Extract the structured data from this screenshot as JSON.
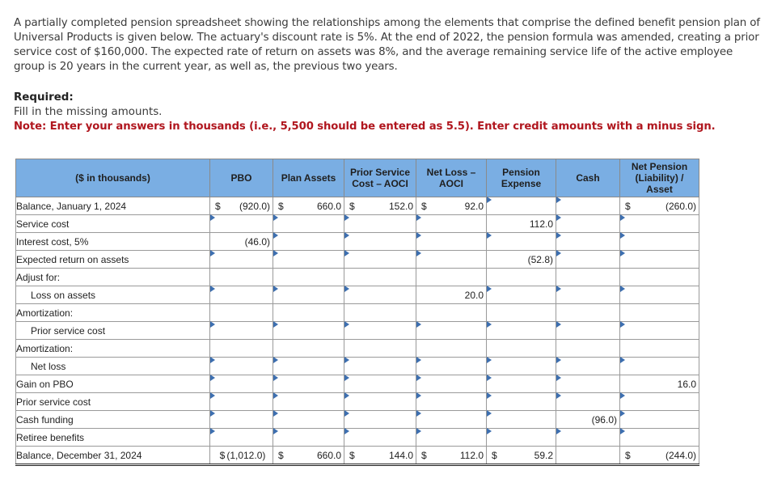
{
  "problem": {
    "intro": "A partially completed pension spreadsheet showing the relationships among the elements that comprise the defined benefit pension plan of Universal Products is given below. The actuary's discount rate is 5%. At the end of 2022, the pension formula was amended, creating a prior service cost of $160,000. The expected rate of return on assets was 8%, and the average remaining service life of the active employee group is 20 years in the current year, as well as, the previous two years.",
    "required_title": "Required:",
    "required_text": "Fill in the missing amounts.",
    "note": "Note: Enter your answers in thousands (i.e., 5,500 should be entered as 5.5). Enter credit amounts with a minus sign."
  },
  "table": {
    "headers": [
      "($ in thousands)",
      "PBO",
      "Plan Assets",
      "Prior Service Cost – AOCI",
      "Net Loss – AOCI",
      "Pension Expense",
      "Cash",
      "Net Pension (Liability) / Asset"
    ],
    "rows": [
      {
        "label": "Balance, January 1, 2024",
        "indent": false,
        "cells": [
          {
            "type": "static",
            "dollar": "$",
            "value": "(920.0)"
          },
          {
            "type": "static",
            "dollar": "$",
            "value": "660.0"
          },
          {
            "type": "static",
            "dollar": "$",
            "value": "152.0"
          },
          {
            "type": "static",
            "dollar": "$",
            "value": "92.0"
          },
          {
            "type": "input",
            "value": ""
          },
          {
            "type": "input",
            "value": ""
          },
          {
            "type": "static",
            "dollar": "$",
            "value": "(260.0)"
          }
        ]
      },
      {
        "label": "Service cost",
        "indent": false,
        "cells": [
          {
            "type": "input",
            "value": ""
          },
          {
            "type": "input",
            "value": ""
          },
          {
            "type": "input",
            "value": ""
          },
          {
            "type": "input",
            "value": ""
          },
          {
            "type": "static",
            "dollar": "",
            "value": "112.0"
          },
          {
            "type": "input",
            "value": ""
          },
          {
            "type": "input",
            "value": ""
          }
        ]
      },
      {
        "label": "Interest cost, 5%",
        "indent": false,
        "cells": [
          {
            "type": "static",
            "dollar": "",
            "value": "(46.0)"
          },
          {
            "type": "input",
            "value": ""
          },
          {
            "type": "input",
            "value": ""
          },
          {
            "type": "input",
            "value": ""
          },
          {
            "type": "input",
            "value": ""
          },
          {
            "type": "input",
            "value": ""
          },
          {
            "type": "input",
            "value": ""
          }
        ]
      },
      {
        "label": "Expected return on assets",
        "indent": false,
        "cells": [
          {
            "type": "input",
            "value": ""
          },
          {
            "type": "input",
            "value": ""
          },
          {
            "type": "input",
            "value": ""
          },
          {
            "type": "input",
            "value": ""
          },
          {
            "type": "static",
            "dollar": "",
            "value": "(52.8)"
          },
          {
            "type": "input",
            "value": ""
          },
          {
            "type": "input",
            "value": ""
          }
        ]
      },
      {
        "label": "Adjust for:",
        "indent": false,
        "cells": [
          {
            "type": "blank"
          },
          {
            "type": "blank"
          },
          {
            "type": "blank"
          },
          {
            "type": "blank"
          },
          {
            "type": "blank"
          },
          {
            "type": "blank"
          },
          {
            "type": "blank"
          }
        ]
      },
      {
        "label": "Loss on assets",
        "indent": true,
        "cells": [
          {
            "type": "input",
            "value": ""
          },
          {
            "type": "input",
            "value": ""
          },
          {
            "type": "input",
            "value": ""
          },
          {
            "type": "static",
            "dollar": "",
            "value": "20.0"
          },
          {
            "type": "input",
            "value": ""
          },
          {
            "type": "input",
            "value": ""
          },
          {
            "type": "input",
            "value": ""
          }
        ]
      },
      {
        "label": "Amortization:",
        "indent": false,
        "cells": [
          {
            "type": "blank"
          },
          {
            "type": "blank"
          },
          {
            "type": "blank"
          },
          {
            "type": "blank"
          },
          {
            "type": "blank"
          },
          {
            "type": "blank"
          },
          {
            "type": "blank"
          }
        ]
      },
      {
        "label": "Prior service cost",
        "indent": true,
        "cells": [
          {
            "type": "input",
            "value": ""
          },
          {
            "type": "input",
            "value": ""
          },
          {
            "type": "input",
            "value": ""
          },
          {
            "type": "input",
            "value": ""
          },
          {
            "type": "input",
            "value": ""
          },
          {
            "type": "input",
            "value": ""
          },
          {
            "type": "input",
            "value": ""
          }
        ]
      },
      {
        "label": "Amortization:",
        "indent": false,
        "cells": [
          {
            "type": "blank"
          },
          {
            "type": "blank"
          },
          {
            "type": "blank"
          },
          {
            "type": "blank"
          },
          {
            "type": "blank"
          },
          {
            "type": "blank"
          },
          {
            "type": "blank"
          }
        ]
      },
      {
        "label": "Net loss",
        "indent": true,
        "cells": [
          {
            "type": "input",
            "value": ""
          },
          {
            "type": "input",
            "value": ""
          },
          {
            "type": "input",
            "value": ""
          },
          {
            "type": "input",
            "value": ""
          },
          {
            "type": "input",
            "value": ""
          },
          {
            "type": "input",
            "value": ""
          },
          {
            "type": "input",
            "value": ""
          }
        ]
      },
      {
        "label": "Gain on PBO",
        "indent": false,
        "cells": [
          {
            "type": "input",
            "value": ""
          },
          {
            "type": "input",
            "value": ""
          },
          {
            "type": "input",
            "value": ""
          },
          {
            "type": "input",
            "value": ""
          },
          {
            "type": "input",
            "value": ""
          },
          {
            "type": "input",
            "value": ""
          },
          {
            "type": "static",
            "dollar": "",
            "value": "16.0"
          }
        ]
      },
      {
        "label": "Prior service cost",
        "indent": false,
        "cells": [
          {
            "type": "input",
            "value": ""
          },
          {
            "type": "input",
            "value": ""
          },
          {
            "type": "input",
            "value": ""
          },
          {
            "type": "input",
            "value": ""
          },
          {
            "type": "input",
            "value": ""
          },
          {
            "type": "input",
            "value": ""
          },
          {
            "type": "input",
            "value": ""
          }
        ]
      },
      {
        "label": "Cash funding",
        "indent": false,
        "cells": [
          {
            "type": "input",
            "value": ""
          },
          {
            "type": "input",
            "value": ""
          },
          {
            "type": "input",
            "value": ""
          },
          {
            "type": "input",
            "value": ""
          },
          {
            "type": "input",
            "value": ""
          },
          {
            "type": "static",
            "dollar": "",
            "value": "(96.0)"
          },
          {
            "type": "input",
            "value": ""
          }
        ]
      },
      {
        "label": "Retiree benefits",
        "indent": false,
        "cells": [
          {
            "type": "input",
            "value": ""
          },
          {
            "type": "input",
            "value": ""
          },
          {
            "type": "input",
            "value": ""
          },
          {
            "type": "input",
            "value": ""
          },
          {
            "type": "input",
            "value": ""
          },
          {
            "type": "input",
            "value": ""
          },
          {
            "type": "input",
            "value": ""
          }
        ]
      },
      {
        "label": "Balance, December 31, 2024",
        "indent": false,
        "total": true,
        "cells": [
          {
            "type": "static",
            "dollar": "$",
            "value": "(1,012.0)",
            "tight": true
          },
          {
            "type": "static",
            "dollar": "$",
            "value": "660.0"
          },
          {
            "type": "static",
            "dollar": "$",
            "value": "144.0"
          },
          {
            "type": "static",
            "dollar": "$",
            "value": "112.0"
          },
          {
            "type": "static",
            "dollar": "$",
            "value": "59.2"
          },
          {
            "type": "blank"
          },
          {
            "type": "static",
            "dollar": "$",
            "value": "(244.0)"
          }
        ]
      }
    ]
  }
}
